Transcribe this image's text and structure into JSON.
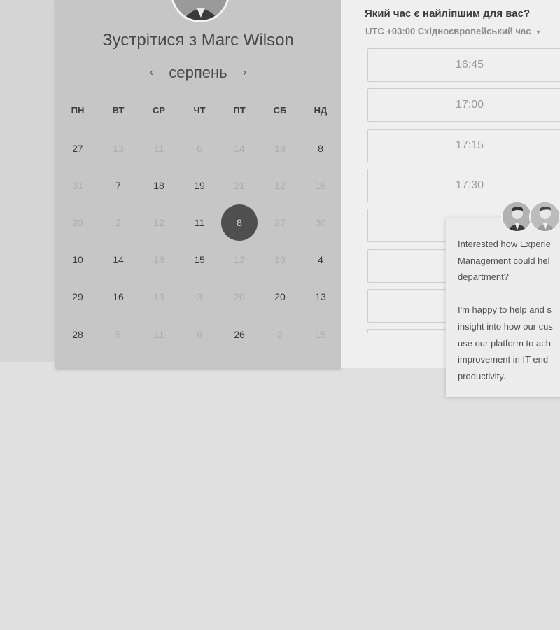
{
  "booking": {
    "title": "Зустрітися з Marc Wilson",
    "month": "серпень",
    "prev_icon": "‹",
    "next_icon": "›",
    "weekdays": [
      "ПН",
      "ВТ",
      "СР",
      "ЧТ",
      "ПТ",
      "СБ",
      "НД"
    ],
    "weeks": [
      [
        {
          "d": "27",
          "s": "active"
        },
        {
          "d": "13",
          "s": "inactive"
        },
        {
          "d": "11",
          "s": "inactive"
        },
        {
          "d": "6",
          "s": "inactive"
        },
        {
          "d": "14",
          "s": "inactive"
        },
        {
          "d": "18",
          "s": "inactive"
        },
        {
          "d": "8",
          "s": "active"
        }
      ],
      [
        {
          "d": "31",
          "s": "inactive"
        },
        {
          "d": "7",
          "s": "active"
        },
        {
          "d": "18",
          "s": "active"
        },
        {
          "d": "19",
          "s": "active"
        },
        {
          "d": "21",
          "s": "inactive"
        },
        {
          "d": "12",
          "s": "inactive"
        },
        {
          "d": "18",
          "s": "inactive"
        }
      ],
      [
        {
          "d": "20",
          "s": "inactive"
        },
        {
          "d": "2",
          "s": "inactive"
        },
        {
          "d": "12",
          "s": "inactive"
        },
        {
          "d": "11",
          "s": "active"
        },
        {
          "d": "8",
          "s": "selected"
        },
        {
          "d": "27",
          "s": "inactive"
        },
        {
          "d": "30",
          "s": "inactive"
        }
      ],
      [
        {
          "d": "10",
          "s": "active"
        },
        {
          "d": "14",
          "s": "active"
        },
        {
          "d": "18",
          "s": "inactive"
        },
        {
          "d": "15",
          "s": "active"
        },
        {
          "d": "13",
          "s": "inactive"
        },
        {
          "d": "19",
          "s": "inactive"
        },
        {
          "d": "4",
          "s": "active"
        }
      ],
      [
        {
          "d": "29",
          "s": "active"
        },
        {
          "d": "16",
          "s": "active"
        },
        {
          "d": "13",
          "s": "inactive"
        },
        {
          "d": "3",
          "s": "inactive"
        },
        {
          "d": "20",
          "s": "inactive"
        },
        {
          "d": "20",
          "s": "active"
        },
        {
          "d": "13",
          "s": "active"
        }
      ],
      [
        {
          "d": "28",
          "s": "active"
        },
        {
          "d": "5",
          "s": "inactive"
        },
        {
          "d": "11",
          "s": "inactive"
        },
        {
          "d": "8",
          "s": "inactive"
        },
        {
          "d": "26",
          "s": "active"
        },
        {
          "d": "2",
          "s": "inactive"
        },
        {
          "d": "15",
          "s": "inactive"
        }
      ]
    ]
  },
  "times": {
    "heading": "Який час є найліпшим для вас?",
    "timezone": "UTC +03:00 Східноєвропейський час",
    "caret_icon": "chevron-down-icon",
    "slots": [
      "16:45",
      "17:00",
      "17:15",
      "17:30",
      "",
      "",
      "",
      ""
    ]
  },
  "chat": {
    "message": "Interested how Experie\nManagement could hel\ndepartment?\n\nI'm happy to help and s\ninsight into how our cus\nuse our platform to ach\nimprovement in IT end-\nproductivity."
  },
  "colors": {
    "selected_day": "#4f4f4f",
    "left_panel": "#c6c6c6",
    "right_panel": "#efefef"
  }
}
